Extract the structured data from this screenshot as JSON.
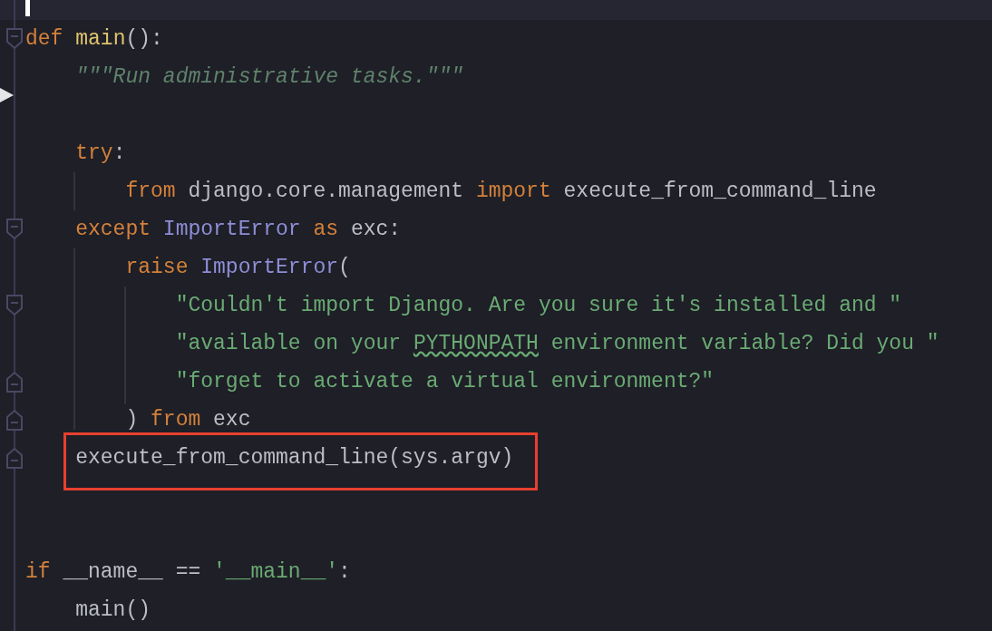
{
  "editor": {
    "lines": [
      {
        "kind": "fold_start",
        "annotated": false,
        "tokens": [
          {
            "kind": "keyword",
            "text": "def"
          },
          {
            "kind": "function",
            "text": " main"
          },
          {
            "kind": "plain",
            "text": "():"
          }
        ]
      },
      {
        "kind": "plain",
        "annotated": false,
        "tokens": [
          {
            "kind": "docstring",
            "text": "    \"\"\"Run administrative tasks.\"\"\""
          }
        ]
      },
      {
        "kind": "plain",
        "annotated": false
      },
      {
        "kind": "plain",
        "annotated": false,
        "tokens": [
          {
            "kind": "keyword",
            "text": "    try"
          },
          {
            "kind": "plain",
            "text": ":"
          }
        ]
      },
      {
        "kind": "plain",
        "annotated": false,
        "tokens": [
          {
            "kind": "keyword",
            "text": "        from"
          },
          {
            "kind": "plain",
            "text": " django.core.management "
          },
          {
            "kind": "keyword",
            "text": "import"
          },
          {
            "kind": "plain",
            "text": " execute_from_command_line"
          }
        ]
      },
      {
        "kind": "fold_start",
        "annotated": false,
        "tokens": [
          {
            "kind": "keyword",
            "text": "    except"
          },
          {
            "kind": "builtin",
            "text": " ImportError"
          },
          {
            "kind": "keyword",
            "text": " as"
          },
          {
            "kind": "plain",
            "text": " exc:"
          }
        ]
      },
      {
        "kind": "plain",
        "annotated": false,
        "tokens": [
          {
            "kind": "keyword",
            "text": "        raise"
          },
          {
            "kind": "builtin",
            "text": " ImportError"
          },
          {
            "kind": "plain",
            "text": "("
          }
        ]
      },
      {
        "kind": "fold_start",
        "annotated": false,
        "tokens": [
          {
            "kind": "string",
            "text": "            \"Couldn't import Django. Are you sure it's installed and \""
          }
        ]
      },
      {
        "kind": "plain",
        "annotated": false,
        "tokens": [
          {
            "kind": "string",
            "text": "            \"available on your "
          },
          {
            "kind": "string_flagged",
            "text": "PYTHONPATH"
          },
          {
            "kind": "string",
            "text": " environment variable? Did you \""
          }
        ]
      },
      {
        "kind": "fold_end",
        "annotated": false,
        "tokens": [
          {
            "kind": "string",
            "text": "            \"forget to activate a virtual environment?\""
          }
        ]
      },
      {
        "kind": "fold_end",
        "annotated": false,
        "tokens": [
          {
            "kind": "plain",
            "text": "        )"
          },
          {
            "kind": "keyword",
            "text": " from"
          },
          {
            "kind": "plain",
            "text": " exc"
          }
        ]
      },
      {
        "kind": "fold_end",
        "annotated": true,
        "tokens": [
          {
            "kind": "plain",
            "text": "    execute_from_command_line(sys.argv)"
          }
        ]
      },
      {
        "kind": "plain",
        "annotated": false
      },
      {
        "kind": "plain",
        "annotated": false
      },
      {
        "kind": "plain",
        "annotated": false,
        "tokens": [
          {
            "kind": "keyword",
            "text": "if"
          },
          {
            "kind": "plain",
            "text": " __name__ == "
          },
          {
            "kind": "string",
            "text": "'__main__'"
          },
          {
            "kind": "plain",
            "text": ":"
          }
        ]
      },
      {
        "kind": "plain",
        "annotated": false,
        "tokens": [
          {
            "kind": "plain",
            "text": "    main()"
          }
        ]
      }
    ]
  }
}
